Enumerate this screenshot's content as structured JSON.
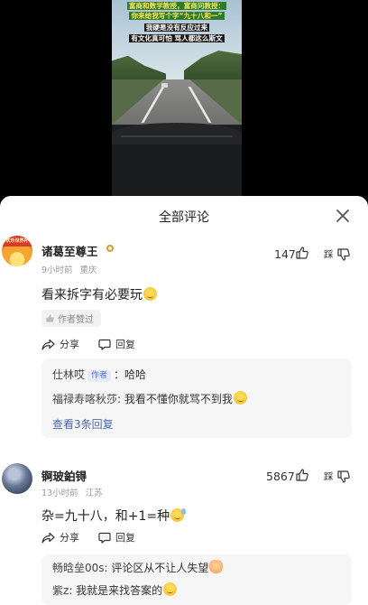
{
  "video": {
    "overlay_lines": [
      "富商和数学教授，富商问教授：",
      "你来给我写个字“九十八和一”",
      "我硬是没有反应过来",
      "有文化真可怕 骂人都这么斯文"
    ]
  },
  "panel": {
    "title": "全部评论",
    "comments": [
      {
        "username": "诸葛至尊王",
        "time": "9小时前",
        "location": "重庆",
        "text": "看来拆字有必要玩",
        "likes": "147",
        "dislike_label": "踩",
        "author_liked": "作者赞过",
        "share_label": "分享",
        "reply_label": "回复",
        "avatar_banner": "欢乐世界杯",
        "replies": [
          {
            "name": "仕林哎",
            "tag": "作者",
            "text": "：哈哈"
          },
          {
            "name": "福禄寿喀秋莎",
            "tag": "",
            "text": ": 我看不懂你就骂不到我"
          }
        ],
        "more_replies": "查看3条回复"
      },
      {
        "username": "锕玻鉑锝",
        "time": "13小时前",
        "location": "江苏",
        "text": "杂=九十八，和+1=种",
        "likes": "5867",
        "dislike_label": "踩",
        "share_label": "分享",
        "reply_label": "回复",
        "replies": [
          {
            "name": "畅晗垒00s",
            "tag": "",
            "text": ": 评论区从不让人失望"
          },
          {
            "name": "紫z",
            "tag": "",
            "text": ": 我就是来找答案的"
          }
        ]
      }
    ]
  },
  "colors": {
    "accent_blue": "#4867b6",
    "overlay_yellow": "#f5e85a",
    "overlay_green": "#2f7b2e"
  },
  "icons": {
    "close": "close-icon",
    "like": "thumb-up-icon",
    "dislike": "thumb-down-icon",
    "share": "share-icon",
    "reply": "reply-bubble-icon"
  }
}
